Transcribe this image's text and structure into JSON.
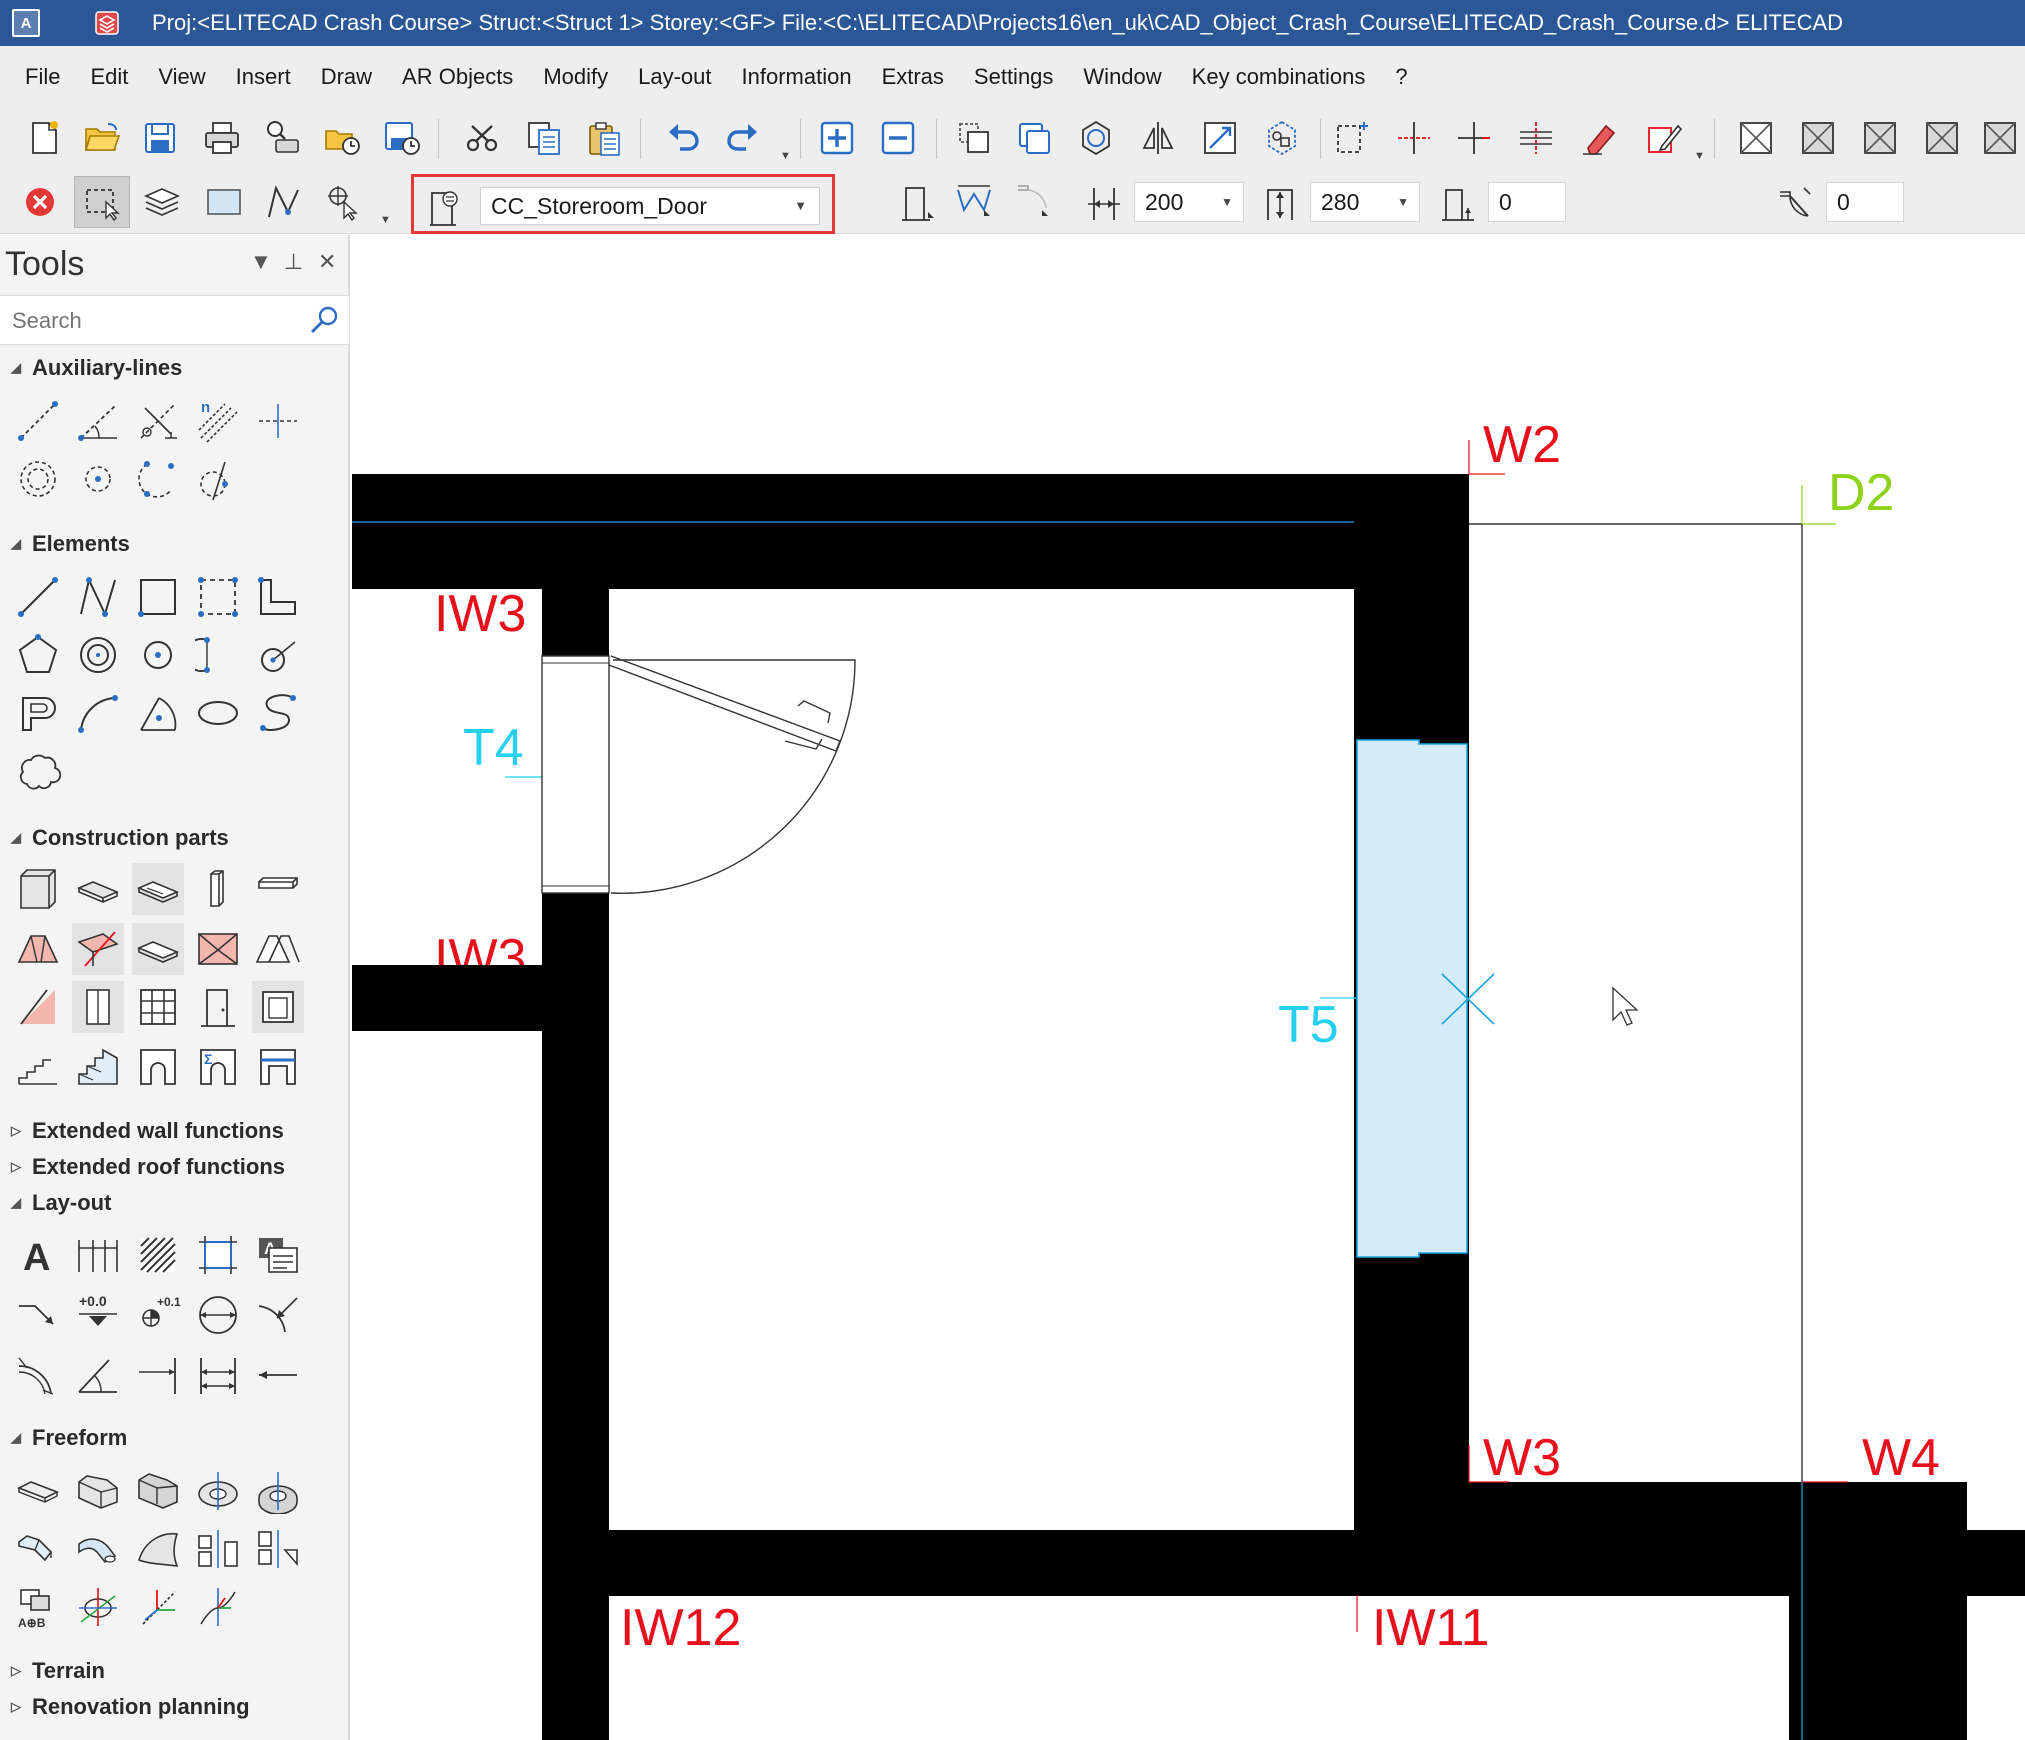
{
  "title_bar": {
    "app_icon_letter": "A",
    "title": "Proj:<ELITECAD Crash Course>  Struct:<Struct 1>   Storey:<GF>   File:<C:\\ELITECAD\\Projects16\\en_uk\\CAD_Object_Crash_Course\\ELITECAD_Crash_Course.d>  ELITECAD"
  },
  "menu": [
    "File",
    "Edit",
    "View",
    "Insert",
    "Draw",
    "AR Objects",
    "Modify",
    "Lay-out",
    "Information",
    "Extras",
    "Settings",
    "Window",
    "Key combinations",
    "?"
  ],
  "toolbar2": {
    "door_type": "CC_Storeroom_Door",
    "width_value": "200",
    "height_value": "280",
    "sill_value": "0",
    "angle_value": "0"
  },
  "tools": {
    "title": "Tools",
    "search_placeholder": "Search",
    "sections": {
      "auxiliary": "Auxiliary-lines",
      "elements": "Elements",
      "construction": "Construction parts",
      "ext_wall": "Extended wall functions",
      "ext_roof": "Extended roof functions",
      "layout": "Lay-out",
      "freeform": "Freeform",
      "terrain": "Terrain",
      "renovation": "Renovation planning"
    },
    "icon_text": {
      "parallel_n": "n",
      "height_label": "+0.0",
      "level_label": "+0.1",
      "text_tool": "A",
      "text_tool_small": "A",
      "aob": "A⊕B"
    }
  },
  "canvas": {
    "labels": {
      "w2": "W2",
      "d2": "D2",
      "iw3": "IW3",
      "iw3_partial": "IW3",
      "t4": "T4",
      "t5": "T5",
      "w3": "W3",
      "w4": "W4",
      "iw12": "IW12",
      "iw11": "IW11"
    },
    "colors": {
      "wall": "#000000",
      "wall_label": "#e8101b",
      "door_label": "#26d0ee",
      "dim_label": "#8fd21b",
      "door_fill": "#d4ebfb",
      "door_stroke": "#1aa3e0"
    }
  }
}
